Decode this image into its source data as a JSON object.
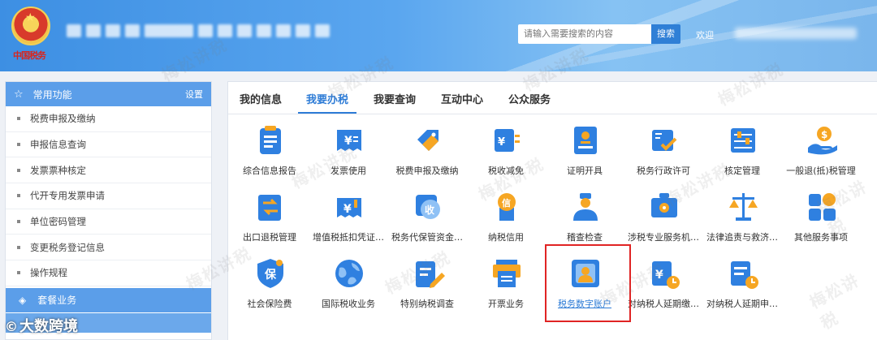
{
  "header": {
    "logo_text": "中国税务",
    "search_placeholder": "请输入需要搜索的内容",
    "search_button": "搜索",
    "welcome": "欢迎"
  },
  "sidebar": {
    "title": "常用功能",
    "settings": "设置",
    "items": [
      "税费申报及缴纳",
      "申报信息查询",
      "发票票种核定",
      "代开专用发票申请",
      "单位密码管理",
      "变更税务登记信息",
      "操作规程"
    ],
    "package_section": "套餐业务"
  },
  "brand_overlay": "大数跨境",
  "watermark": "梅松讲税",
  "tabs": [
    {
      "label": "我的信息"
    },
    {
      "label": "我要办税"
    },
    {
      "label": "我要查询"
    },
    {
      "label": "互动中心"
    },
    {
      "label": "公众服务"
    }
  ],
  "services": [
    {
      "label": "综合信息报告",
      "icon": "clipboard-list-icon"
    },
    {
      "label": "发票使用",
      "icon": "invoice-yuan-icon"
    },
    {
      "label": "税费申报及缴纳",
      "icon": "tax-tag-icon"
    },
    {
      "label": "税收减免",
      "icon": "tax-reduction-icon"
    },
    {
      "label": "证明开具",
      "icon": "certificate-stamp-icon"
    },
    {
      "label": "税务行政许可",
      "icon": "license-check-icon"
    },
    {
      "label": "核定管理",
      "icon": "adjust-panel-icon"
    },
    {
      "label": "一般退(抵)税管理",
      "icon": "hand-coin-icon"
    },
    {
      "label": "出口退税管理",
      "icon": "export-refund-icon"
    },
    {
      "label": "增值税抵扣凭证…",
      "icon": "vat-voucher-icon"
    },
    {
      "label": "税务代保管资金…",
      "icon": "custody-fund-icon"
    },
    {
      "label": "纳税信用",
      "icon": "credit-medal-icon"
    },
    {
      "label": "稽查检查",
      "icon": "inspector-icon"
    },
    {
      "label": "涉税专业服务机…",
      "icon": "briefcase-gear-icon"
    },
    {
      "label": "法律追责与救济…",
      "icon": "scales-icon"
    },
    {
      "label": "其他服务事项",
      "icon": "tiles-icon"
    },
    {
      "label": "社会保险费",
      "icon": "shield-bao-icon"
    },
    {
      "label": "国际税收业务",
      "icon": "globe-icon"
    },
    {
      "label": "特别纳税调查",
      "icon": "pencil-doc-icon"
    },
    {
      "label": "开票业务",
      "icon": "printer-icon"
    },
    {
      "label": "税务数字账户",
      "icon": "account-person-icon"
    },
    {
      "label": "对纳税人延期缴…",
      "icon": "deferral-payment-icon"
    },
    {
      "label": "对纳税人延期申…",
      "icon": "deferral-filing-icon"
    }
  ],
  "colors": {
    "primary_blue": "#2e7cd6",
    "icon_blue": "#2f80e0",
    "icon_orange": "#f6a623",
    "highlight_red": "#e02424"
  }
}
